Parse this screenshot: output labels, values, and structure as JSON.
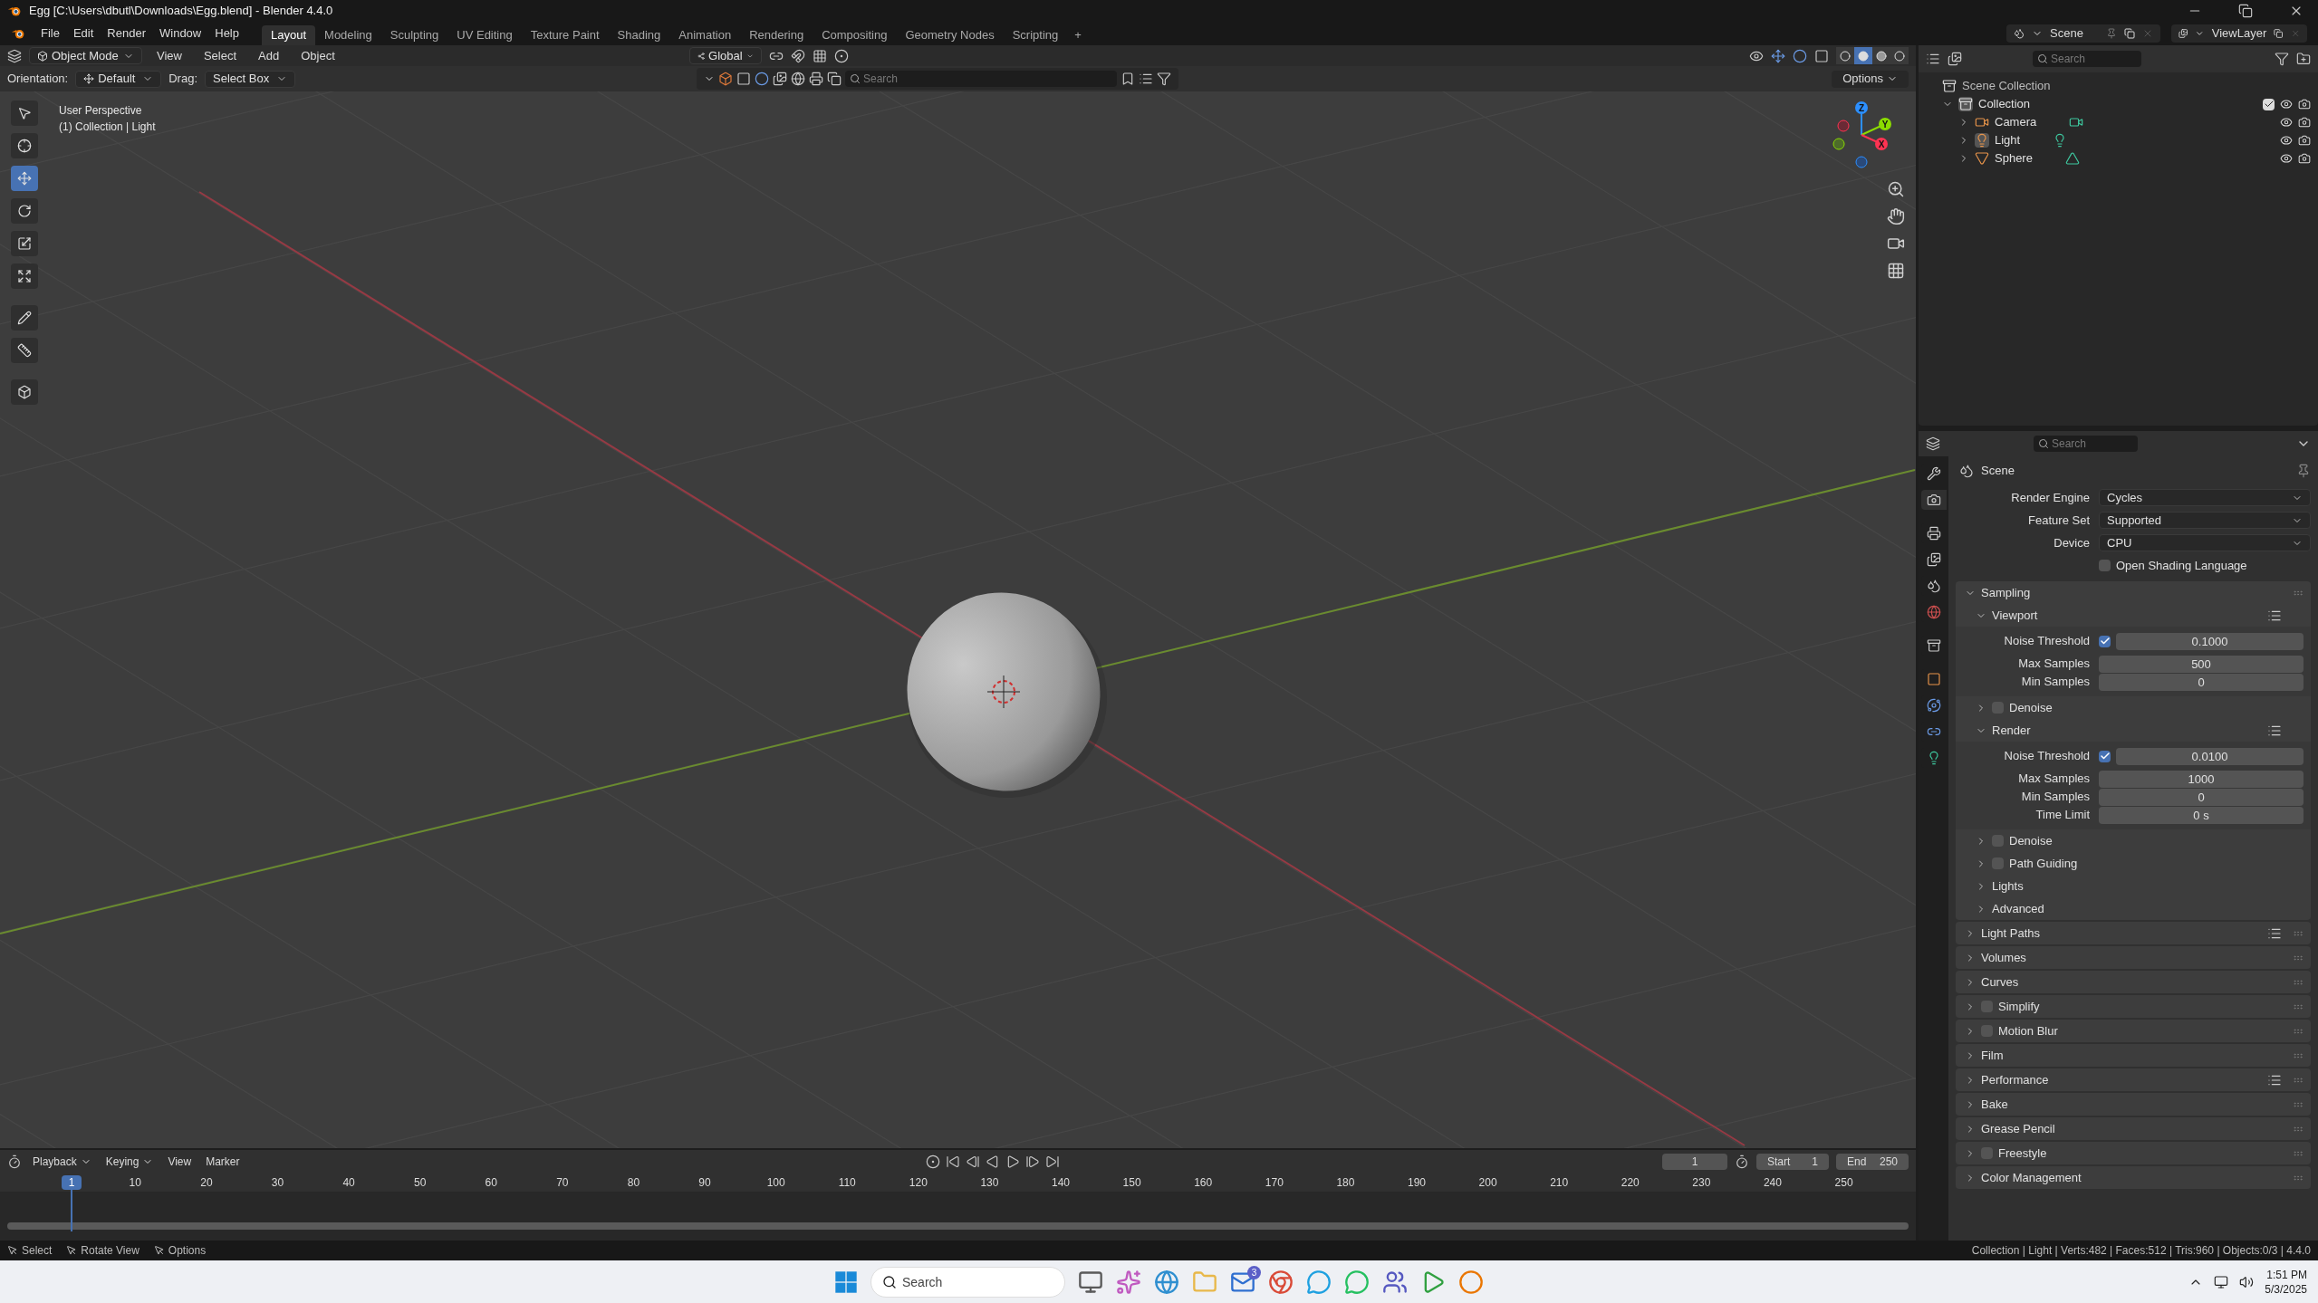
{
  "window": {
    "title": "Egg [C:\\Users\\dbutl\\Downloads\\Egg.blend] - Blender 4.4.0"
  },
  "menu": [
    "File",
    "Edit",
    "Render",
    "Window",
    "Help"
  ],
  "workspaces": [
    {
      "label": "Layout",
      "selected": true
    },
    {
      "label": "Modeling",
      "selected": false
    },
    {
      "label": "Sculpting",
      "selected": false
    },
    {
      "label": "UV Editing",
      "selected": false
    },
    {
      "label": "Texture Paint",
      "selected": false
    },
    {
      "label": "Shading",
      "selected": false
    },
    {
      "label": "Animation",
      "selected": false
    },
    {
      "label": "Rendering",
      "selected": false
    },
    {
      "label": "Compositing",
      "selected": false
    },
    {
      "label": "Geometry Nodes",
      "selected": false
    },
    {
      "label": "Scripting",
      "selected": false
    }
  ],
  "add_workspace": "+",
  "scene_selector": {
    "value": "Scene"
  },
  "view_layer": {
    "value": "ViewLayer"
  },
  "viewport": {
    "mode": "Object Mode",
    "menus": [
      "View",
      "Select",
      "Add",
      "Object"
    ],
    "transform_orientation": "Global",
    "shading": [
      {
        "kind": "wireframe",
        "selected": false
      },
      {
        "kind": "solid",
        "selected": true
      },
      {
        "kind": "material",
        "selected": false
      },
      {
        "kind": "rendered",
        "selected": false
      }
    ],
    "tool_settings": {
      "orientation_label": "Orientation:",
      "orientation": "Default",
      "drag_label": "Drag:",
      "drag": "Select Box"
    },
    "search": {
      "placeholder": "Search"
    },
    "options": "Options",
    "view_name": "User Perspective",
    "context": "(1) Collection | Light",
    "tools": [
      {
        "kind": "select",
        "selected": false
      },
      {
        "kind": "cursor",
        "selected": false
      },
      {
        "kind": "move",
        "selected": true
      },
      {
        "kind": "rotate",
        "selected": false
      },
      {
        "kind": "scale",
        "selected": false
      },
      {
        "kind": "transform",
        "selected": false
      },
      {
        "kind": "annotate",
        "selected": false
      },
      {
        "kind": "measure",
        "selected": false
      },
      {
        "kind": "add_cube",
        "selected": false
      }
    ],
    "gizmo_axes": [
      "X",
      "Y",
      "Z"
    ]
  },
  "timeline": {
    "menus": [
      "Playback",
      "Keying",
      "View",
      "Marker"
    ],
    "current_frame": "1",
    "start_label": "Start",
    "start": "1",
    "end_label": "End",
    "end": "250",
    "playhead": "1",
    "ticks": [
      "10",
      "20",
      "30",
      "40",
      "50",
      "60",
      "70",
      "80",
      "90",
      "100",
      "110",
      "120",
      "130",
      "140",
      "150",
      "160",
      "170",
      "180",
      "190",
      "200",
      "210",
      "220",
      "230",
      "240",
      "250"
    ]
  },
  "outliner": {
    "search": {
      "placeholder": "Search"
    },
    "items": [
      {
        "label": "Scene Collection",
        "kind": "scene_collection",
        "children": [
          {
            "label": "Collection",
            "kind": "collection",
            "expanded": true,
            "checked": true,
            "children": [
              {
                "label": "Camera",
                "kind": "camera",
                "expanded": false
              },
              {
                "label": "Light",
                "kind": "light",
                "expanded": false
              },
              {
                "label": "Sphere",
                "kind": "mesh",
                "expanded": false
              }
            ]
          }
        ]
      }
    ]
  },
  "properties": {
    "search": {
      "placeholder": "Search"
    },
    "context": "Scene",
    "tabs": [
      {
        "kind": "tool",
        "selected": false
      },
      {
        "kind": "render",
        "selected": true
      },
      {
        "kind": "output",
        "selected": false
      },
      {
        "kind": "view_layer",
        "selected": false
      },
      {
        "kind": "scene",
        "selected": false
      },
      {
        "kind": "world",
        "selected": false
      },
      {
        "kind": "collection",
        "selected": false
      },
      {
        "kind": "object",
        "selected": false
      },
      {
        "kind": "physics",
        "selected": false
      },
      {
        "kind": "constraints",
        "selected": false
      },
      {
        "kind": "data",
        "selected": false
      }
    ],
    "fields": [
      {
        "label": "Render Engine",
        "value": "Cycles"
      },
      {
        "label": "Feature Set",
        "value": "Supported"
      },
      {
        "label": "Device",
        "value": "CPU"
      }
    ],
    "osl": {
      "label": "Open Shading Language",
      "checked": false
    },
    "panels": [
      {
        "label": "Sampling",
        "expanded": true,
        "subpanels": [
          {
            "label": "Viewport",
            "expanded": true,
            "presets": true,
            "rows": [
              {
                "label": "Noise Threshold",
                "checked": true,
                "value": "0.1000"
              },
              {
                "label": "Max Samples",
                "value": "500"
              },
              {
                "label": "Min Samples",
                "value": "0"
              }
            ]
          },
          {
            "label": "Denoise",
            "expanded": false,
            "checked": false
          },
          {
            "label": "Render",
            "expanded": true,
            "presets": true,
            "rows": [
              {
                "label": "Noise Threshold",
                "checked": true,
                "value": "0.0100"
              },
              {
                "label": "Max Samples",
                "value": "1000"
              },
              {
                "label": "Min Samples",
                "value": "0"
              },
              {
                "label": "Time Limit",
                "value": "0 s"
              }
            ]
          },
          {
            "label": "Denoise",
            "expanded": false,
            "checked": false
          },
          {
            "label": "Path Guiding",
            "expanded": false,
            "checked": false
          },
          {
            "label": "Lights",
            "expanded": false
          },
          {
            "label": "Advanced",
            "expanded": false
          }
        ]
      },
      {
        "label": "Light Paths",
        "expanded": false,
        "presets": true
      },
      {
        "label": "Volumes",
        "expanded": false
      },
      {
        "label": "Curves",
        "expanded": false
      },
      {
        "label": "Simplify",
        "expanded": false,
        "checked": false
      },
      {
        "label": "Motion Blur",
        "expanded": false,
        "checked": false
      },
      {
        "label": "Film",
        "expanded": false
      },
      {
        "label": "Performance",
        "expanded": false,
        "presets": true
      },
      {
        "label": "Bake",
        "expanded": false
      },
      {
        "label": "Grease Pencil",
        "expanded": false
      },
      {
        "label": "Freestyle",
        "expanded": false,
        "checked": false
      },
      {
        "label": "Color Management",
        "expanded": false
      }
    ]
  },
  "status_bar": {
    "hints": [
      "Select",
      "Rotate View",
      "Options"
    ],
    "stats": "Collection | Light | Verts:482 | Faces:512 | Tris:960 | Objects:0/3 | 4.4.0"
  },
  "taskbar": {
    "search": {
      "placeholder": "Search"
    },
    "badge": "3",
    "time": "1:51 PM",
    "date": "5/3/2025"
  }
}
